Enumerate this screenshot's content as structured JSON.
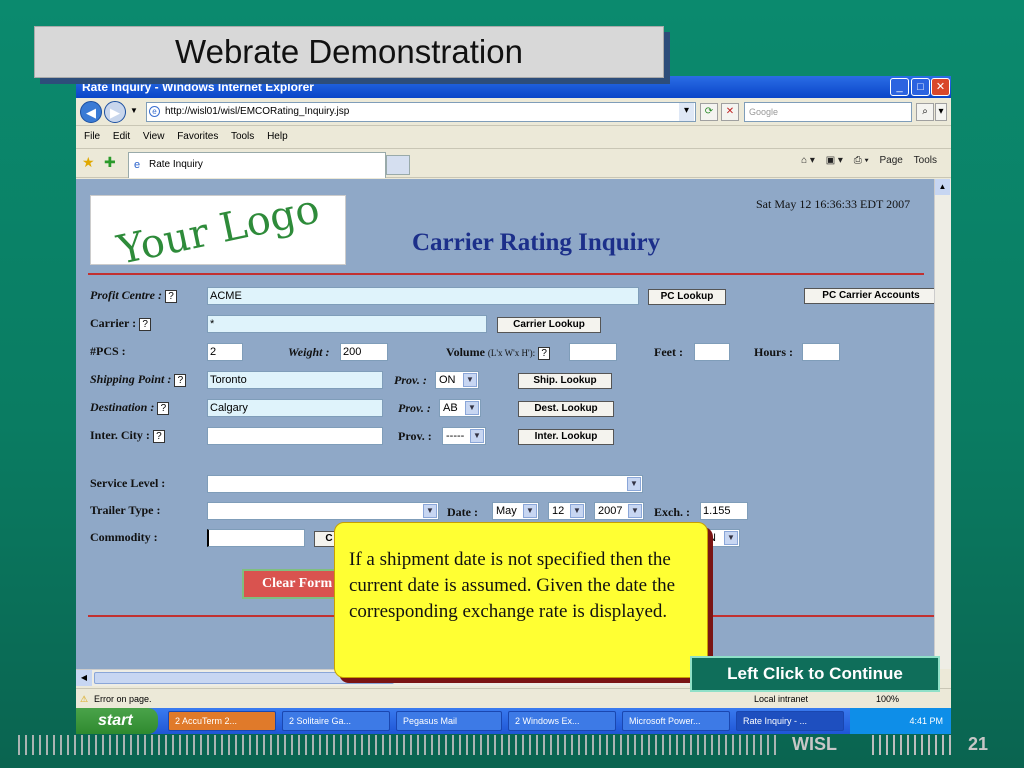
{
  "slide": {
    "title": "Webrate Demonstration",
    "page_number": "21",
    "footer_brand": "WISL",
    "callout": "If a shipment date is not specified then the current date is assumed. Given the date the corresponding exchange rate is displayed.",
    "continue_label": "Left Click to Continue"
  },
  "browser": {
    "window_title": "Rate Inquiry - Windows Internet Explorer",
    "url": "http://wisl01/wisl/EMCORating_Inquiry.jsp",
    "search_placeholder": "Google",
    "menu": [
      "File",
      "Edit",
      "View",
      "Favorites",
      "Tools",
      "Help"
    ],
    "tab_label": "Rate Inquiry",
    "commands": {
      "page": "Page",
      "tools": "Tools"
    },
    "status_left": "Error on page.",
    "status_zone": "Local intranet",
    "zoom": "100%"
  },
  "taskbar": {
    "start": "start",
    "tasks": [
      "2 AccuTerm 2...",
      "2 Solitaire Ga...",
      "Pegasus Mail",
      "2 Windows Ex...",
      "Microsoft Power...",
      "Rate Inquiry - ..."
    ],
    "clock": "4:41 PM"
  },
  "form": {
    "logo_text": "Your Logo",
    "datetime": "Sat May 12 16:36:33 EDT 2007",
    "title": "Carrier Rating Inquiry",
    "profit_centre_label": "Profit Centre :",
    "profit_centre_value": "ACME",
    "pc_lookup": "PC Lookup",
    "pc_carrier_accounts": "PC Carrier Accounts",
    "carrier_label": "Carrier :",
    "carrier_value": "*",
    "carrier_lookup": "Carrier Lookup",
    "pcs_label": "#PCS :",
    "pcs_value": "2",
    "weight_label": "Weight :",
    "weight_value": "200",
    "volume_label": "Volume",
    "volume_hint": "(L'x W'x H'):",
    "feet_label": "Feet :",
    "hours_label": "Hours :",
    "shipping_label": "Shipping Point :",
    "shipping_value": "Toronto",
    "prov_label": "Prov. :",
    "shipping_prov": "ON",
    "ship_lookup": "Ship. Lookup",
    "dest_label": "Destination :",
    "dest_value": "Calgary",
    "dest_prov": "AB",
    "dest_lookup": "Dest. Lookup",
    "inter_label": "Inter. City :",
    "inter_prov": "-----",
    "inter_lookup": "Inter. Lookup",
    "service_label": "Service Level :",
    "trailer_label": "Trailer Type :",
    "date_label": "Date :",
    "month": "May",
    "day": "12",
    "year": "2007",
    "exch_label": "Exch. :",
    "exch_value": "1.155",
    "commodity_label": "Commodity :",
    "commodity_btn": "C",
    "currency": "N",
    "clear_label": "Clear Form",
    "q": "?"
  }
}
